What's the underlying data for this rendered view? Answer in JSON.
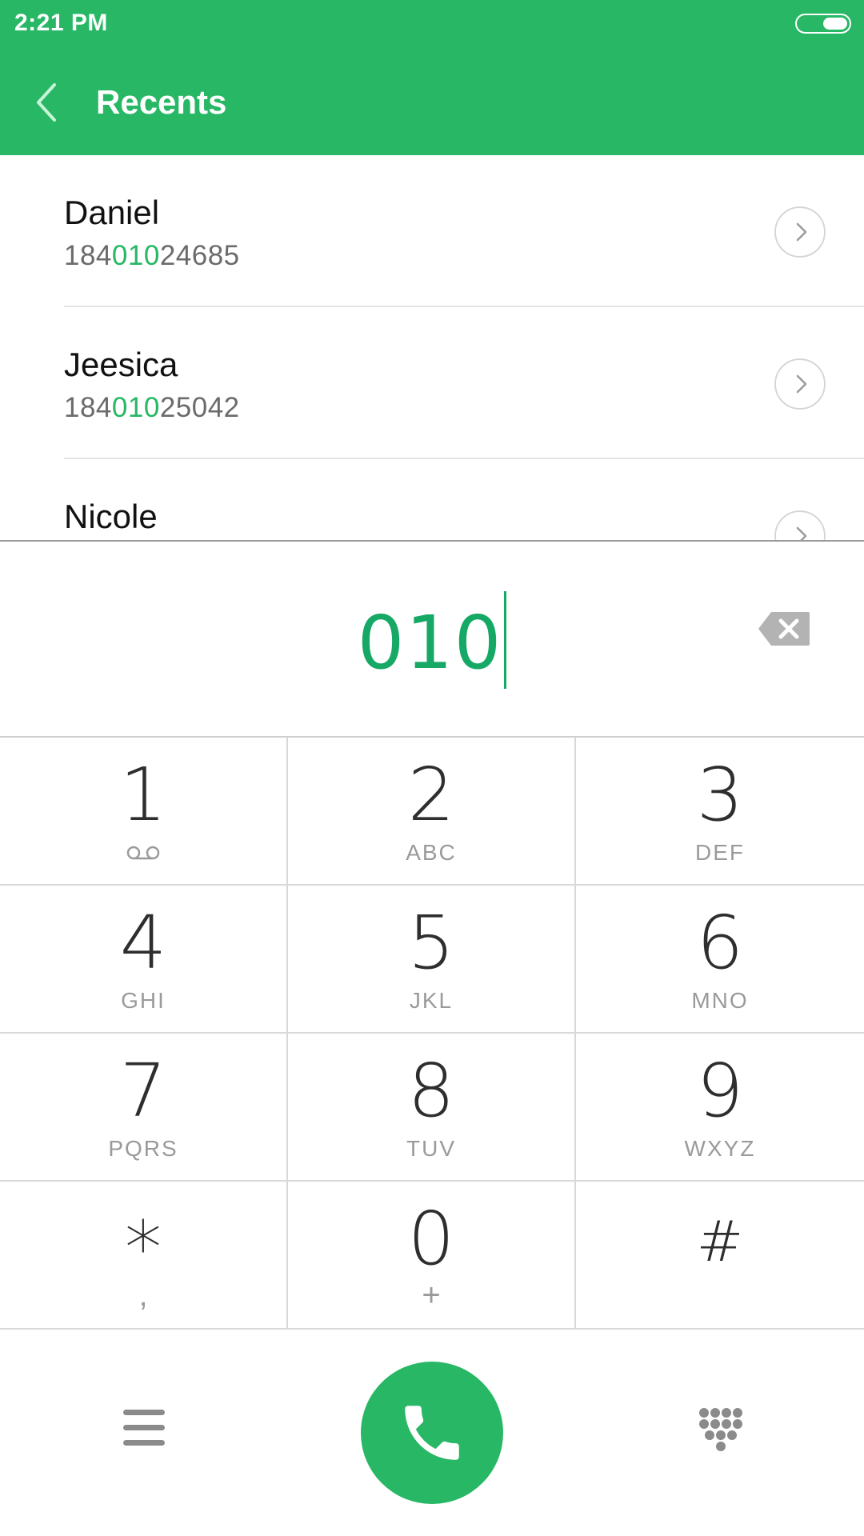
{
  "status_bar": {
    "time": "2:21 PM"
  },
  "header": {
    "title": "Recents"
  },
  "recents": [
    {
      "name": "Daniel",
      "number_prefix": "184",
      "number_match": "010",
      "number_suffix": "24685"
    },
    {
      "name": "Jeesica",
      "number_prefix": "184",
      "number_match": "010",
      "number_suffix": "25042"
    },
    {
      "name": "Nicole"
    }
  ],
  "dialer": {
    "input_value": "010"
  },
  "keys": [
    {
      "digit": "1",
      "letters": ""
    },
    {
      "digit": "2",
      "letters": "ABC"
    },
    {
      "digit": "3",
      "letters": "DEF"
    },
    {
      "digit": "4",
      "letters": "GHI"
    },
    {
      "digit": "5",
      "letters": "JKL"
    },
    {
      "digit": "6",
      "letters": "MNO"
    },
    {
      "digit": "7",
      "letters": "PQRS"
    },
    {
      "digit": "8",
      "letters": "TUV"
    },
    {
      "digit": "9",
      "letters": "WXYZ"
    },
    {
      "digit": "*",
      "sub": ","
    },
    {
      "digit": "0",
      "sub": "+"
    },
    {
      "digit": "#",
      "sub": ""
    }
  ],
  "icons": {
    "back": "back-arrow-icon",
    "detail": "chevron-right-icon",
    "backspace": "backspace-icon",
    "voicemail": "voicemail-icon",
    "menu": "menu-icon",
    "call": "phone-icon",
    "dialpad": "dialpad-icon"
  },
  "colors": {
    "accent": "#27b765",
    "dialed_text": "#16a865"
  }
}
